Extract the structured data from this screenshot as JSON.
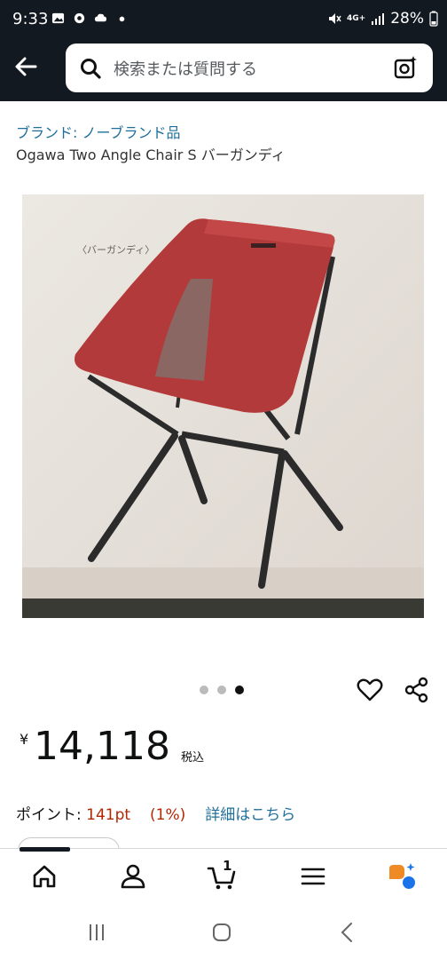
{
  "status_bar": {
    "time": "9:33",
    "network": "4G+",
    "battery": "28%",
    "icons": [
      "image-icon",
      "app-icon",
      "cloud-icon",
      "dot-icon",
      "mute-icon",
      "signal-icon",
      "battery-icon"
    ]
  },
  "search": {
    "placeholder": "検索または質問する"
  },
  "product": {
    "brand": "ブランド: ノーブランド品",
    "title": "Ogawa Two Angle Chair S バーガンディ",
    "image_caption": "〈バーガンディ〉",
    "carousel": {
      "count": 3,
      "active_index": 2
    },
    "price_symbol": "¥",
    "price": "14,118",
    "tax_label": "税込",
    "points_label": "ポイント: ",
    "points_value": "141pt",
    "points_percent": "(1%)",
    "details_link": "詳細はこちら"
  },
  "bottom_nav": {
    "items": [
      "home-icon",
      "account-icon",
      "cart-icon",
      "menu-icon",
      "rufus-icon"
    ],
    "cart_count": "1",
    "active": "home"
  },
  "colors": {
    "header_bg": "#131921",
    "link": "#1f6f9a",
    "price_points": "#b12704",
    "chair_red": "#b33a3a"
  }
}
